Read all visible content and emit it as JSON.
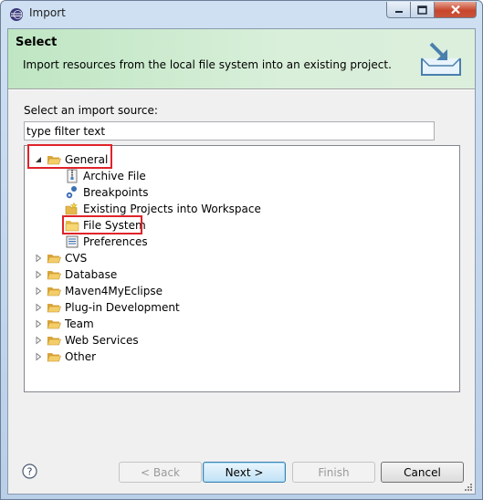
{
  "window": {
    "title": "Import",
    "app_icon": "eclipse-icon",
    "controls": [
      "minimize-icon",
      "maximize-icon",
      "close-icon"
    ]
  },
  "header": {
    "title": "Select",
    "description": "Import resources from the local file system into an existing project.",
    "icon": "import-wizard-icon"
  },
  "source": {
    "label": "Select an import source:",
    "filter_value": "type filter text"
  },
  "tree": {
    "general": {
      "label": "General",
      "expanded": true,
      "children": [
        {
          "label": "Archive File",
          "icon": "archive-file-icon"
        },
        {
          "label": "Breakpoints",
          "icon": "breakpoints-icon"
        },
        {
          "label": "Existing Projects into Workspace",
          "icon": "existing-projects-icon"
        },
        {
          "label": "File System",
          "icon": "folder-icon"
        },
        {
          "label": "Preferences",
          "icon": "preferences-icon"
        }
      ]
    },
    "categories": [
      "CVS",
      "Database",
      "Maven4MyEclipse",
      "Plug-in Development",
      "Team",
      "Web Services",
      "Other"
    ]
  },
  "buttons": {
    "back": "< Back",
    "next": "Next >",
    "finish": "Finish",
    "cancel": "Cancel"
  },
  "colors": {
    "highlight": "#e0232a",
    "header_bg": "#d9efda",
    "folder": "#e7b84a"
  }
}
